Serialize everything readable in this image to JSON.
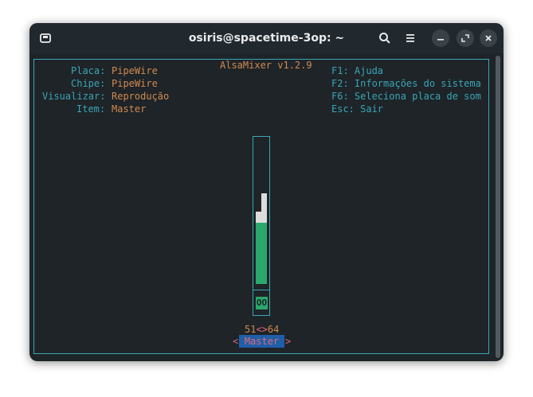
{
  "window": {
    "title": "osiris@spacetime-3op: ~",
    "icons": [
      "new-tab-icon",
      "search-icon",
      "hamburger-menu-icon",
      "minimize-icon",
      "maximize-icon",
      "close-icon"
    ]
  },
  "alsamixer": {
    "version_title": "AlsaMixer v1.2.9",
    "info": [
      {
        "label": "Placa:",
        "value": "PipeWire"
      },
      {
        "label": "Chipe:",
        "value": "PipeWire"
      },
      {
        "label": "Visualizar:",
        "value": "Reprodução"
      },
      {
        "label": "Item:",
        "value": "Master"
      }
    ],
    "help": [
      "F1: Ajuda",
      "F2: Informações do sistema",
      "F6: Seleciona placa de som",
      "Esc: Sair"
    ],
    "control": {
      "name": "Master",
      "mute_label": "OO",
      "volume_left": "51",
      "volume_sep": "<>",
      "volume_right": "64",
      "left_level": 0.51,
      "right_level": 0.64,
      "arrow_left": "<",
      "arrow_right": ">"
    },
    "colors": {
      "background": "#1e2428",
      "frame": "#39a8b4",
      "label": "#3aa5b6",
      "value": "#d18a4e",
      "bar": "#2aa86b",
      "selected_bg": "#1f5ea8",
      "selected_fg": "#e06a78"
    }
  }
}
